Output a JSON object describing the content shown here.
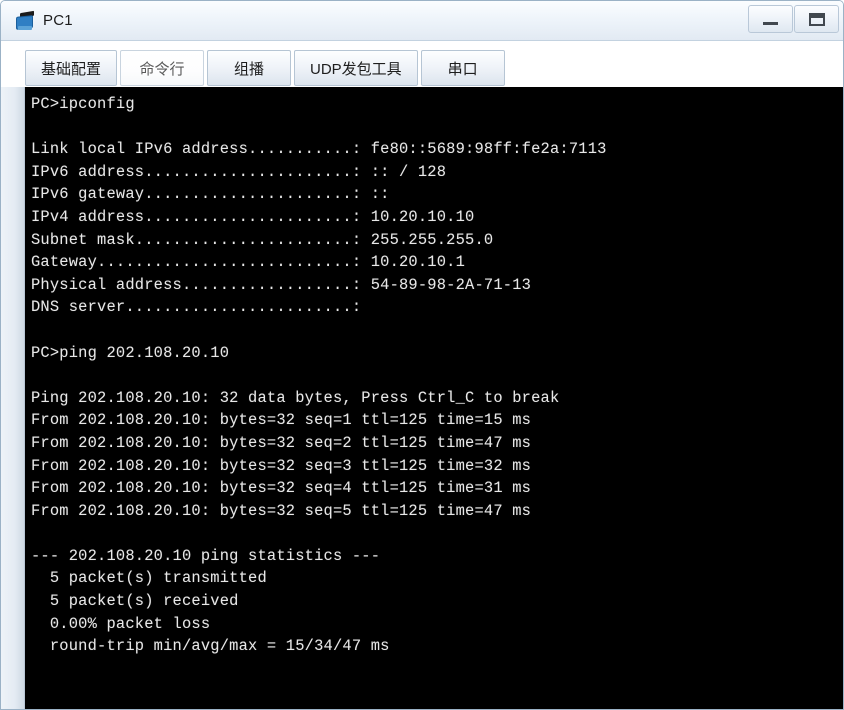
{
  "window": {
    "title": "PC1",
    "icon": "pc-monitor-icon",
    "controls": [
      {
        "name": "minimize-button",
        "glyph": "minimize-icon"
      },
      {
        "name": "maximize-button",
        "glyph": "maximize-icon"
      }
    ]
  },
  "tabs": [
    {
      "label": "基础配置",
      "active": false
    },
    {
      "label": "命令行",
      "active": true
    },
    {
      "label": "组播",
      "active": false
    },
    {
      "label": "UDP发包工具",
      "active": false
    },
    {
      "label": "串口",
      "active": false
    }
  ],
  "terminal": {
    "background": "#000000",
    "foreground": "#e8e8e8",
    "lines": [
      "PC>ipconfig",
      "",
      "Link local IPv6 address...........: fe80::5689:98ff:fe2a:7113",
      "IPv6 address......................: :: / 128",
      "IPv6 gateway......................: ::",
      "IPv4 address......................: 10.20.10.10",
      "Subnet mask.......................: 255.255.255.0",
      "Gateway...........................: 10.20.10.1",
      "Physical address..................: 54-89-98-2A-71-13",
      "DNS server........................:",
      "",
      "PC>ping 202.108.20.10",
      "",
      "Ping 202.108.20.10: 32 data bytes, Press Ctrl_C to break",
      "From 202.108.20.10: bytes=32 seq=1 ttl=125 time=15 ms",
      "From 202.108.20.10: bytes=32 seq=2 ttl=125 time=47 ms",
      "From 202.108.20.10: bytes=32 seq=3 ttl=125 time=32 ms",
      "From 202.108.20.10: bytes=32 seq=4 ttl=125 time=31 ms",
      "From 202.108.20.10: bytes=32 seq=5 ttl=125 time=47 ms",
      "",
      "--- 202.108.20.10 ping statistics ---",
      "  5 packet(s) transmitted",
      "  5 packet(s) received",
      "  0.00% packet loss",
      "  round-trip min/avg/max = 15/34/47 ms"
    ]
  }
}
